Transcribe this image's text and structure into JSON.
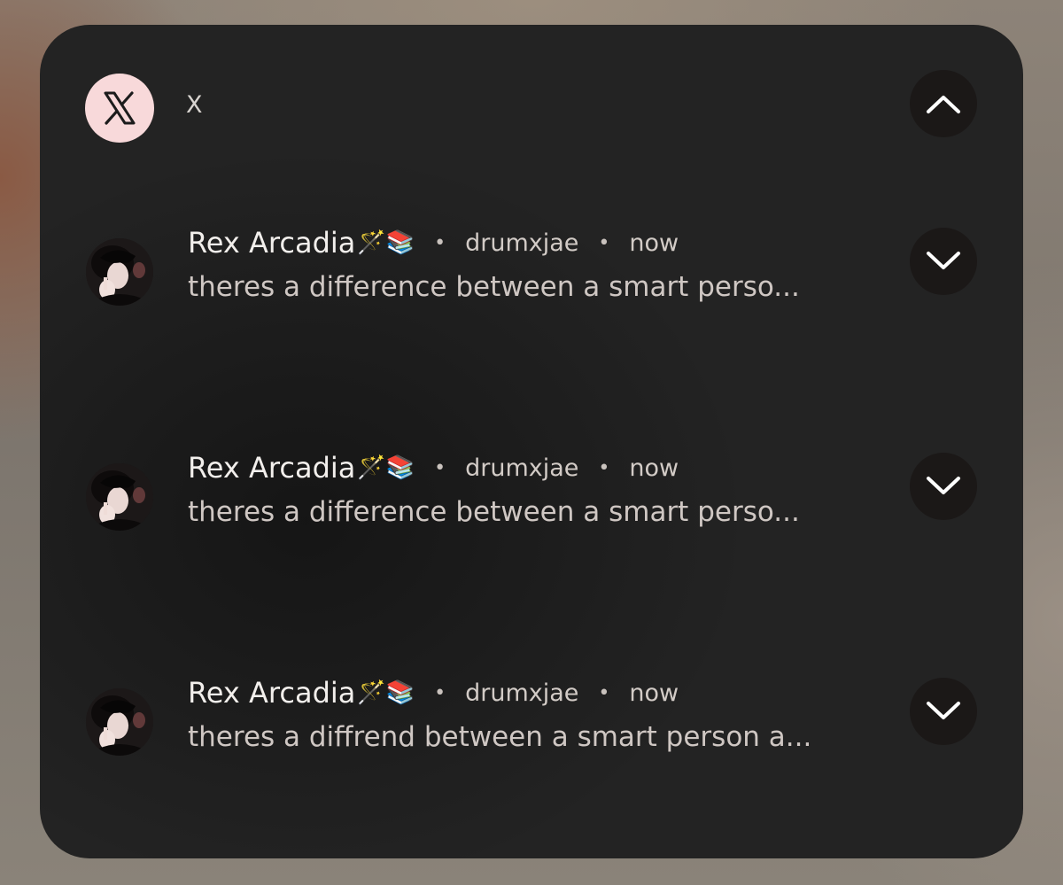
{
  "app": {
    "name": "X",
    "icon": "x-logo-icon",
    "icon_bg": "#f8d9da"
  },
  "header": {
    "collapse_icon": "chevron-up-icon"
  },
  "notifications": [
    {
      "sender": "Rex Arcadia",
      "emoji": "🪄📚",
      "separator": "•",
      "handle": "drumxjae",
      "time": "now",
      "text": "theres a difference between a smart perso...",
      "expand_icon": "chevron-down-icon"
    },
    {
      "sender": "Rex Arcadia",
      "emoji": "🪄📚",
      "separator": "•",
      "handle": "drumxjae",
      "time": "now",
      "text": "theres a difference between a smart perso...",
      "expand_icon": "chevron-down-icon"
    },
    {
      "sender": "Rex Arcadia",
      "emoji": "🪄📚",
      "separator": "•",
      "handle": "drumxjae",
      "time": "now",
      "text": "theres a diffrend between a smart person a...",
      "expand_icon": "chevron-down-icon"
    }
  ]
}
